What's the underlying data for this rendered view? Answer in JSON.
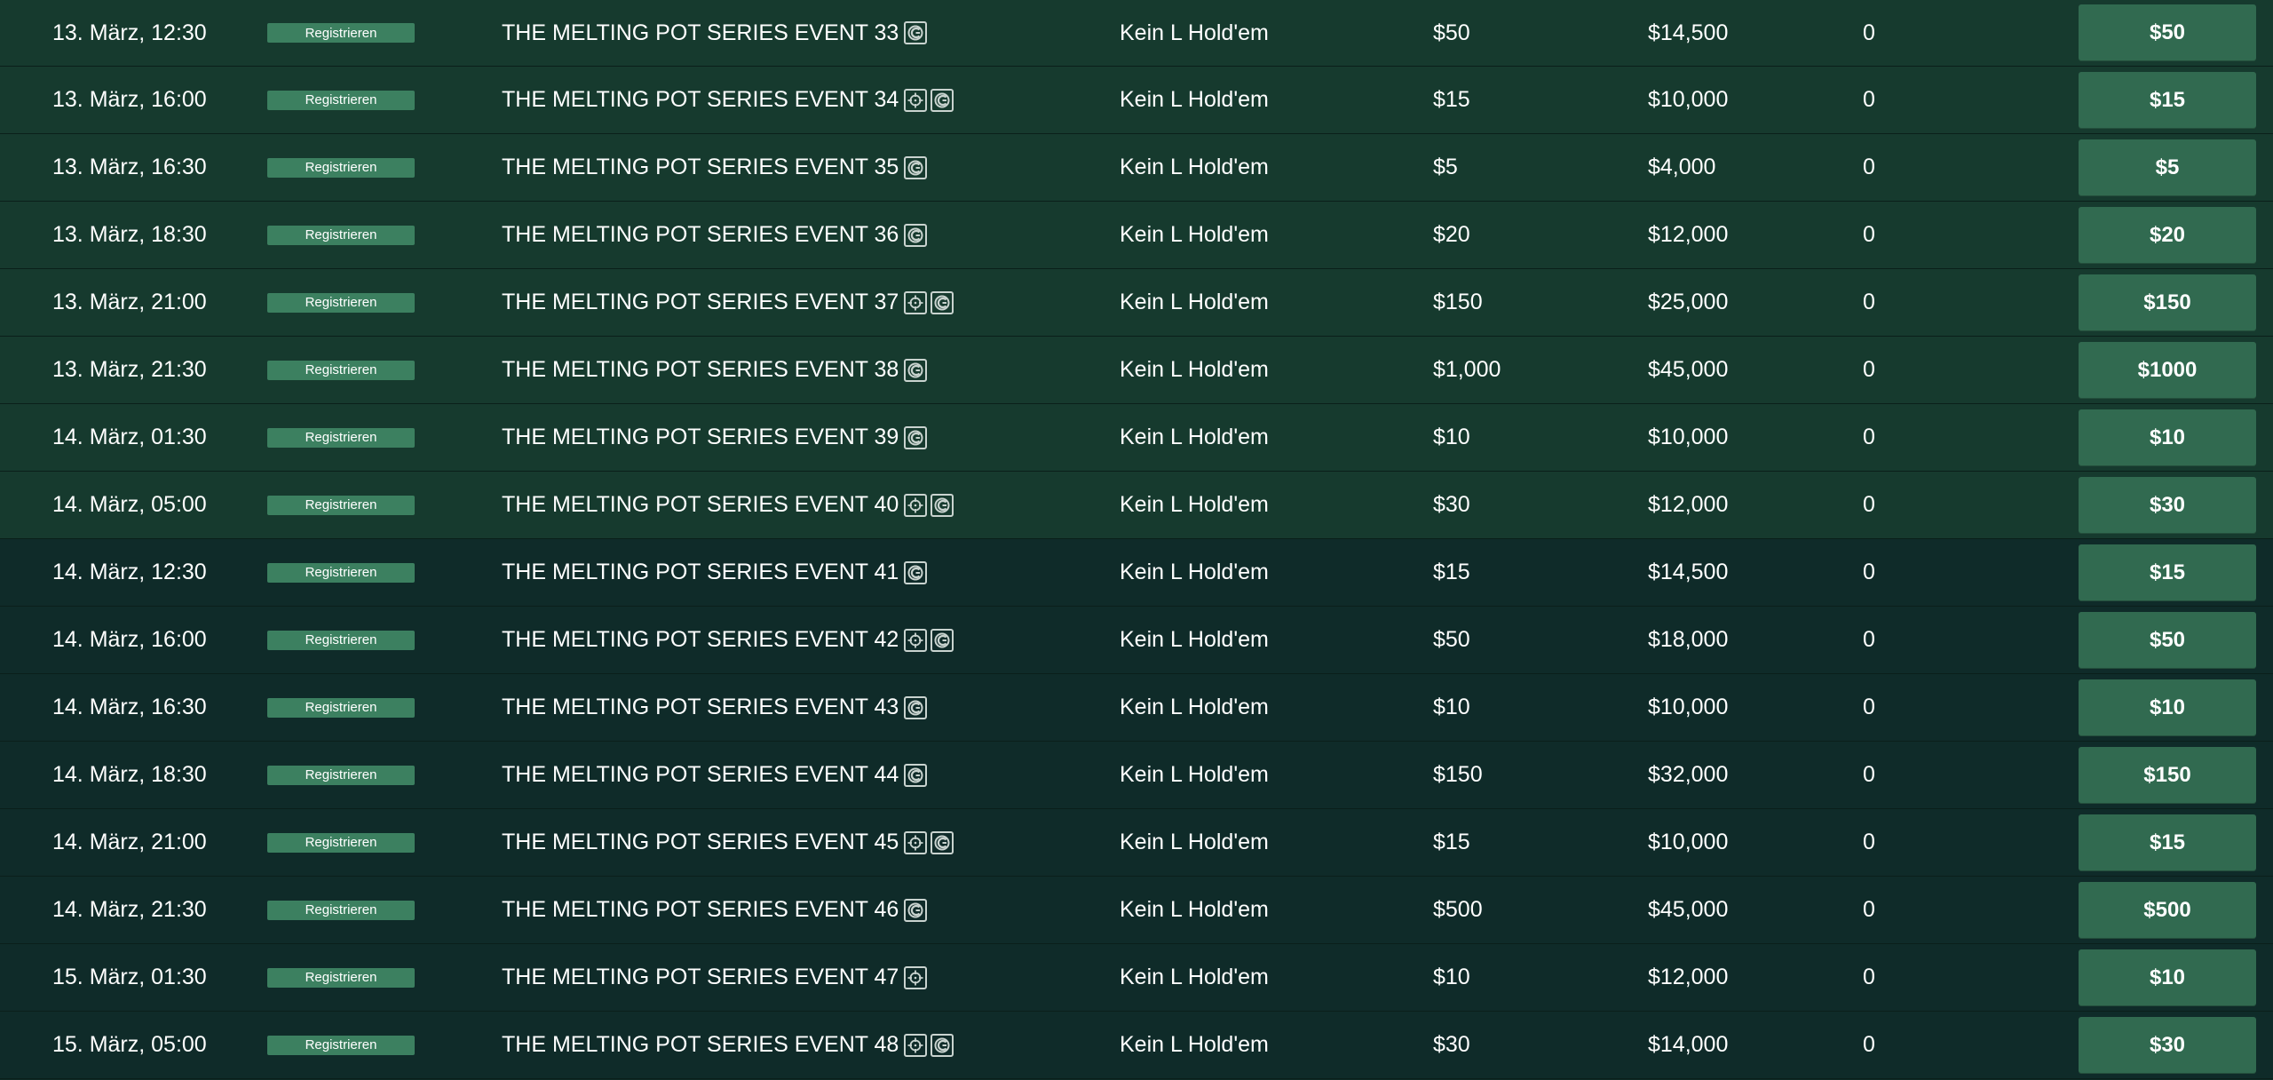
{
  "colors": {
    "row_green": "#163a2e",
    "row_teal": "#0f2b29",
    "register_badge": "#3c8060",
    "buy_button": "#316a50",
    "icon_border": "#c9d3cf"
  },
  "rows": [
    {
      "date": "13. März, 12:30",
      "status": "Registrieren",
      "name": "THE MELTING POT SERIES EVENT 33",
      "icons": [
        "chip-icon"
      ],
      "game": "Kein L Hold'em",
      "buyin": "$50",
      "guarantee": "$14,500",
      "players": "0",
      "button": "$50"
    },
    {
      "date": "13. März, 16:00",
      "status": "Registrieren",
      "name": "THE MELTING POT SERIES EVENT 34",
      "icons": [
        "target-icon",
        "chip-icon"
      ],
      "game": "Kein L Hold'em",
      "buyin": "$15",
      "guarantee": "$10,000",
      "players": "0",
      "button": "$15"
    },
    {
      "date": "13. März, 16:30",
      "status": "Registrieren",
      "name": "THE MELTING POT SERIES EVENT 35",
      "icons": [
        "chip-icon"
      ],
      "game": "Kein L Hold'em",
      "buyin": "$5",
      "guarantee": "$4,000",
      "players": "0",
      "button": "$5"
    },
    {
      "date": "13. März, 18:30",
      "status": "Registrieren",
      "name": "THE MELTING POT SERIES EVENT 36",
      "icons": [
        "chip-icon"
      ],
      "game": "Kein L Hold'em",
      "buyin": "$20",
      "guarantee": "$12,000",
      "players": "0",
      "button": "$20"
    },
    {
      "date": "13. März, 21:00",
      "status": "Registrieren",
      "name": "THE MELTING POT SERIES EVENT 37",
      "icons": [
        "target-icon",
        "chip-icon"
      ],
      "game": "Kein L Hold'em",
      "buyin": "$150",
      "guarantee": "$25,000",
      "players": "0",
      "button": "$150"
    },
    {
      "date": "13. März, 21:30",
      "status": "Registrieren",
      "name": "THE MELTING POT SERIES EVENT 38",
      "icons": [
        "chip-icon"
      ],
      "game": "Kein L Hold'em",
      "buyin": "$1,000",
      "guarantee": "$45,000",
      "players": "0",
      "button": "$1000"
    },
    {
      "date": "14. März, 01:30",
      "status": "Registrieren",
      "name": "THE MELTING POT SERIES EVENT 39",
      "icons": [
        "chip-icon"
      ],
      "game": "Kein L Hold'em",
      "buyin": "$10",
      "guarantee": "$10,000",
      "players": "0",
      "button": "$10"
    },
    {
      "date": "14. März, 05:00",
      "status": "Registrieren",
      "name": "THE MELTING POT SERIES EVENT 40",
      "icons": [
        "target-icon",
        "chip-icon"
      ],
      "game": "Kein L Hold'em",
      "buyin": "$30",
      "guarantee": "$12,000",
      "players": "0",
      "button": "$30"
    },
    {
      "date": "14. März, 12:30",
      "status": "Registrieren",
      "name": "THE MELTING POT SERIES EVENT 41",
      "icons": [
        "chip-icon"
      ],
      "game": "Kein L Hold'em",
      "buyin": "$15",
      "guarantee": "$14,500",
      "players": "0",
      "button": "$15"
    },
    {
      "date": "14. März, 16:00",
      "status": "Registrieren",
      "name": "THE MELTING POT SERIES EVENT 42",
      "icons": [
        "target-icon",
        "chip-icon"
      ],
      "game": "Kein L Hold'em",
      "buyin": "$50",
      "guarantee": "$18,000",
      "players": "0",
      "button": "$50"
    },
    {
      "date": "14. März, 16:30",
      "status": "Registrieren",
      "name": "THE MELTING POT SERIES EVENT 43",
      "icons": [
        "chip-icon"
      ],
      "game": "Kein L Hold'em",
      "buyin": "$10",
      "guarantee": "$10,000",
      "players": "0",
      "button": "$10"
    },
    {
      "date": "14. März, 18:30",
      "status": "Registrieren",
      "name": "THE MELTING POT SERIES EVENT 44",
      "icons": [
        "chip-icon"
      ],
      "game": "Kein L Hold'em",
      "buyin": "$150",
      "guarantee": "$32,000",
      "players": "0",
      "button": "$150"
    },
    {
      "date": "14. März, 21:00",
      "status": "Registrieren",
      "name": "THE MELTING POT SERIES EVENT 45",
      "icons": [
        "target-icon",
        "chip-icon"
      ],
      "game": "Kein L Hold'em",
      "buyin": "$15",
      "guarantee": "$10,000",
      "players": "0",
      "button": "$15"
    },
    {
      "date": "14. März, 21:30",
      "status": "Registrieren",
      "name": "THE MELTING POT SERIES EVENT 46",
      "icons": [
        "chip-icon"
      ],
      "game": "Kein L Hold'em",
      "buyin": "$500",
      "guarantee": "$45,000",
      "players": "0",
      "button": "$500"
    },
    {
      "date": "15. März, 01:30",
      "status": "Registrieren",
      "name": "THE MELTING POT SERIES EVENT 47",
      "icons": [
        "target-icon"
      ],
      "game": "Kein L Hold'em",
      "buyin": "$10",
      "guarantee": "$12,000",
      "players": "0",
      "button": "$10"
    },
    {
      "date": "15. März, 05:00",
      "status": "Registrieren",
      "name": "THE MELTING POT SERIES EVENT 48",
      "icons": [
        "target-icon",
        "chip-icon"
      ],
      "game": "Kein L Hold'em",
      "buyin": "$30",
      "guarantee": "$14,000",
      "players": "0",
      "button": "$30"
    }
  ]
}
